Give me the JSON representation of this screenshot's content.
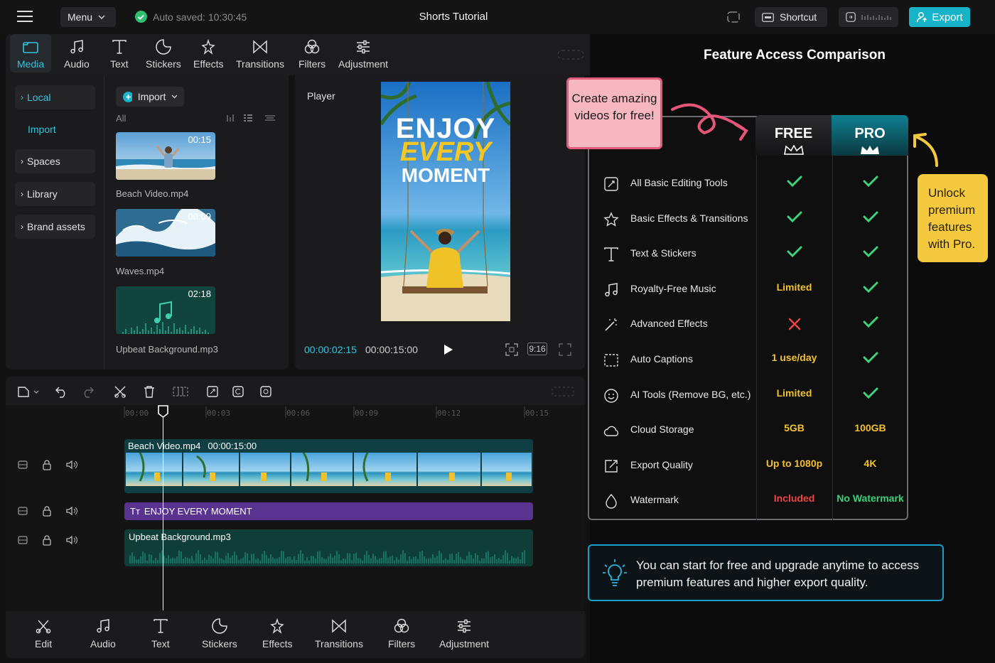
{
  "header": {
    "menu_label": "Menu",
    "autosave": "Auto saved: 10:30:45",
    "project_title": "Shorts Tutorial",
    "shortcut_label": "Shortcut",
    "export_label": "Export"
  },
  "toolbar": {
    "items": [
      {
        "label": "Media",
        "icon": "media-icon",
        "active": true
      },
      {
        "label": "Audio",
        "icon": "music-note-icon"
      },
      {
        "label": "Text",
        "icon": "text-icon"
      },
      {
        "label": "Stickers",
        "icon": "sticker-icon"
      },
      {
        "label": "Effects",
        "icon": "sparkle-icon"
      },
      {
        "label": "Transitions",
        "icon": "bowtie-icon"
      },
      {
        "label": "Filters",
        "icon": "filters-icon"
      },
      {
        "label": "Adjustment",
        "icon": "sliders-icon"
      }
    ]
  },
  "sidebar": {
    "items": [
      {
        "label": "Local",
        "active": true
      },
      {
        "label": "Import"
      },
      {
        "label": "Spaces"
      },
      {
        "label": "Library"
      },
      {
        "label": "Brand assets"
      }
    ]
  },
  "media": {
    "import_label": "Import",
    "filter_label": "All",
    "files": [
      {
        "name": "Beach Video.mp4",
        "duration": "00:15"
      },
      {
        "name": "Waves.mp4",
        "duration": "00:09"
      },
      {
        "name": "Upbeat Background.mp3",
        "duration": "02:18"
      }
    ]
  },
  "player": {
    "title": "Player",
    "overlay_line1": "ENJOY",
    "overlay_line2": "EVERY",
    "overlay_line3": "MOMENT",
    "current_time": "00:00:02:15",
    "total_time": "00:00:15:00",
    "aspect": "9:16"
  },
  "timeline": {
    "ruler": [
      "00:00",
      "00:03",
      "00:06",
      "00:09",
      "00:12",
      "00:15"
    ],
    "video_clip": {
      "name": "Beach Video.mp4",
      "duration": "00:00:15:00"
    },
    "text_clip": "ENJOY EVERY MOMENT",
    "audio_clip": "Upbeat Background.mp3"
  },
  "bottom_toolbar": {
    "items": [
      {
        "label": "Edit",
        "icon": "scissors-icon"
      },
      {
        "label": "Audio",
        "icon": "music-note-icon"
      },
      {
        "label": "Text",
        "icon": "text-icon"
      },
      {
        "label": "Stickers",
        "icon": "sticker-icon"
      },
      {
        "label": "Effects",
        "icon": "sparkle-icon"
      },
      {
        "label": "Transitions",
        "icon": "bowtie-icon"
      },
      {
        "label": "Filters",
        "icon": "filters-icon"
      },
      {
        "label": "Adjustment",
        "icon": "sliders-icon"
      }
    ]
  },
  "comparison": {
    "title": "Feature Access Comparison",
    "free_label": "FREE",
    "pro_label": "PRO",
    "callout_left": "Create amazing videos for free!",
    "callout_right": "Unlock premium features with Pro.",
    "rows": [
      {
        "feature": "All Basic Editing Tools",
        "free": "check",
        "pro": "check"
      },
      {
        "feature": "Basic Effects & Transitions",
        "free": "check",
        "pro": "check"
      },
      {
        "feature": "Text & Stickers",
        "free": "check",
        "pro": "check"
      },
      {
        "feature": "Royalty-Free Music",
        "free": "Limited",
        "pro": "check"
      },
      {
        "feature": "Advanced Effects",
        "free": "cross",
        "pro": "check"
      },
      {
        "feature": "Auto Captions",
        "free": "1 use/day",
        "pro": "check"
      },
      {
        "feature": "AI Tools (Remove BG, etc.)",
        "free": "Limited",
        "pro": "check"
      },
      {
        "feature": "Cloud Storage",
        "free": "5GB",
        "pro": "100GB"
      },
      {
        "feature": "Export Quality",
        "free": "Up to 1080p",
        "pro": "4K"
      },
      {
        "feature": "Watermark",
        "free": "Included",
        "pro": "No Watermark"
      }
    ],
    "tip": "You can start for free and upgrade anytime to access premium features and higher export quality."
  },
  "colors": {
    "accent": "#17b3c9",
    "free_text": "#f3c12c",
    "pro_text": "#3fd17a",
    "bad": "#ef4444"
  }
}
